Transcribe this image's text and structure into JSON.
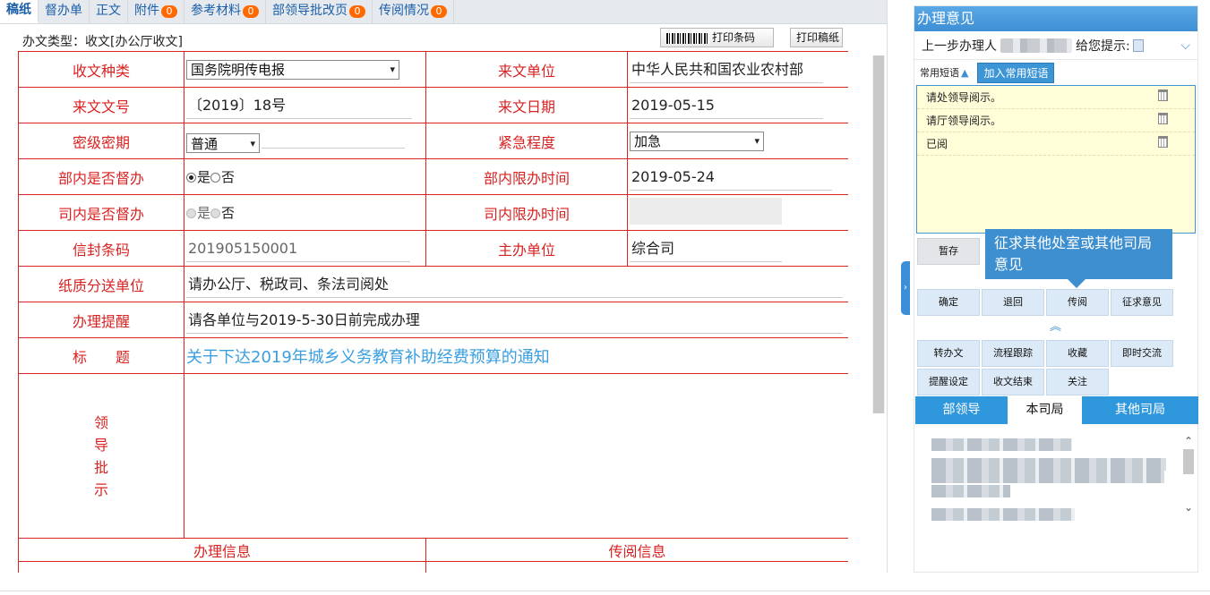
{
  "tabs": [
    {
      "label": "稿纸",
      "active": true
    },
    {
      "label": "督办单"
    },
    {
      "label": "正文"
    },
    {
      "label": "附件",
      "count": "0"
    },
    {
      "label": "参考材料",
      "count": "0"
    },
    {
      "label": "部领导批改页",
      "count": "0"
    },
    {
      "label": "传阅情况",
      "count": "0"
    }
  ],
  "doc_type": "办文类型：收文[办公厅收文]",
  "toolbar": {
    "print_barcode": "打印条码",
    "print_draft": "打印稿纸"
  },
  "form": {
    "doc_kind_label": "收文种类",
    "doc_kind_value": "国务院明传电报",
    "from_unit_label": "来文单位",
    "from_unit_value": "中华人民共和国农业农村部",
    "doc_no_label": "来文文号",
    "doc_no_value": "〔2019〕18号",
    "doc_date_label": "来文日期",
    "doc_date_value": "2019-05-15",
    "secret_label": "密级密期",
    "secret_value": "普通",
    "urgency_label": "紧急程度",
    "urgency_value": "加急",
    "ministry_supervise_label": "部内是否督办",
    "yes": "是",
    "no": "否",
    "ministry_deadline_label": "部内限办时间",
    "ministry_deadline_value": "2019-05-24",
    "dept_supervise_label": "司内是否督办",
    "dept_deadline_label": "司内限办时间",
    "envelope_label": "信封条码",
    "envelope_value": "201905150001",
    "host_unit_label": "主办单位",
    "host_unit_value": "综合司",
    "paper_send_label": "纸质分送单位",
    "paper_send_value": "请办公厅、税政司、条法司阅处",
    "reminder_label": "办理提醒",
    "reminder_value": "请各单位与2019-5-30日前完成办理",
    "title_label": "标　　题",
    "title_value": "关于下达2019年城乡义务教育补助经费预算的通知",
    "leader_label": [
      "领",
      "导",
      "批",
      "示"
    ],
    "handle_info_label": "办理信息",
    "circulate_info_label": "传阅信息"
  },
  "panel": {
    "title": "办理意见",
    "prev_handler": "上一步办理人",
    "hint": "给您提示:",
    "common_phrases": "常用短语",
    "add_phrase": "加入常用短语",
    "phrases": [
      "请处领导阅示。",
      "请厅领导阅示。",
      "已阅"
    ],
    "save": "暂存",
    "tooltip": "征求其他处室或其他司局意见",
    "actions": [
      "确定",
      "退回",
      "传阅",
      "征求意见"
    ],
    "more_actions": [
      "转办文",
      "流程跟踪",
      "收藏",
      "即时交流",
      "提醒设定",
      "收文结束",
      "关注"
    ],
    "org_tabs": [
      "部领导",
      "本司局",
      "其他司局"
    ],
    "active_org_tab": "本司局"
  }
}
